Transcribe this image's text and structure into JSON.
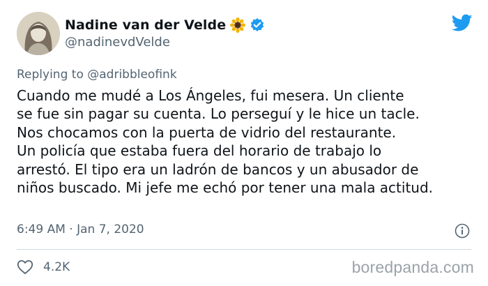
{
  "author": {
    "display_name": "Nadine van der Velde",
    "emoji": "sunflower-icon",
    "verified": true,
    "handle": "@nadinevdVelde",
    "avatar": "avatar-photo"
  },
  "reply": {
    "prefix": "Replying to ",
    "mention": "@adribbleofink"
  },
  "tweet": {
    "lines": [
      "Cuando me mudé a Los Ángeles, fui mesera. Un cliente",
      "se fue sin pagar su cuenta. Lo perseguí y le hice un tacle.",
      "Nos chocamos con la puerta de vidrio del restaurante.",
      "Un policía que estaba fuera del horario de trabajo lo",
      "arrestó. El tipo era un ladrón de bancos y un abusador de",
      "niños buscado. Mi jefe me echó por tener una mala actitud."
    ],
    "timestamp": "6:49 AM · Jan 7, 2020"
  },
  "engagement": {
    "likes": "4.2K"
  },
  "icons": {
    "brand": "twitter-bird-icon",
    "verified": "verified-badge-icon",
    "info": "info-icon",
    "like": "heart-icon"
  },
  "watermark": "boredpanda.com",
  "colors": {
    "text_primary": "#0f1419",
    "text_secondary": "#536471",
    "twitter_blue": "#1d9bf0",
    "divider": "#cfd9de",
    "watermark": "#9aa3a8"
  }
}
